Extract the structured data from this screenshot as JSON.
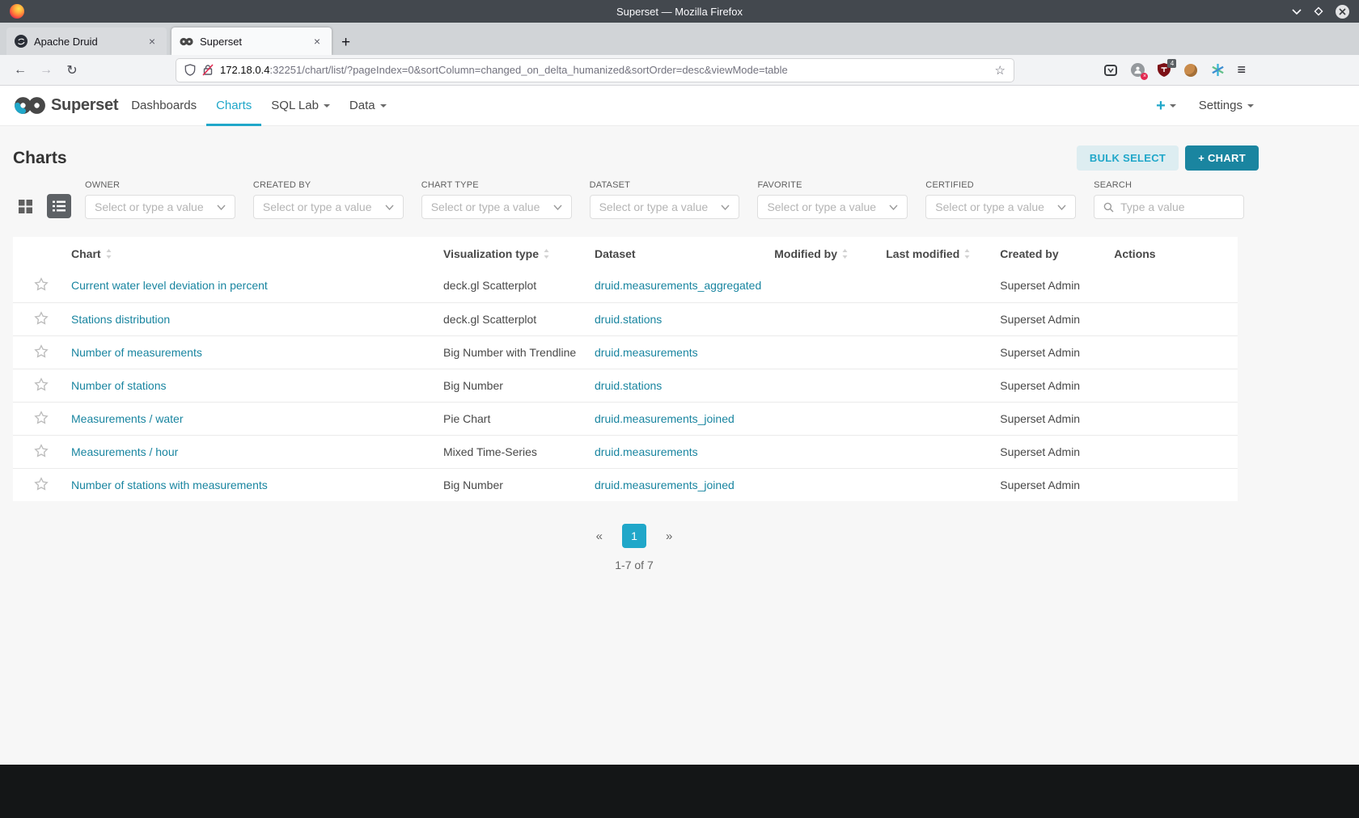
{
  "window": {
    "title": "Superset — Mozilla Firefox",
    "tabs": [
      {
        "title": "Apache Druid"
      },
      {
        "title": "Superset"
      }
    ],
    "url_host": "172.18.0.4",
    "url_rest": ":32251/chart/list/?pageIndex=0&sortColumn=changed_on_delta_humanized&sortOrder=desc&viewMode=table",
    "ublock_badge": "4"
  },
  "icons": {
    "back": "←",
    "forward": "→",
    "reload": "↻",
    "menu": "≡",
    "new_tab": "+",
    "close_tab": "×",
    "bookmark": "☆",
    "close_window": "×"
  },
  "nav": {
    "brand": "Superset",
    "items": [
      {
        "label": "Dashboards"
      },
      {
        "label": "Charts"
      },
      {
        "label": "SQL Lab"
      },
      {
        "label": "Data"
      }
    ],
    "add_label": "+",
    "settings": "Settings"
  },
  "page": {
    "title": "Charts",
    "bulk_select": "BULK SELECT",
    "new_chart": "+ CHART"
  },
  "filters": {
    "owner": {
      "label": "OWNER",
      "placeholder": "Select or type a value"
    },
    "created_by": {
      "label": "CREATED BY",
      "placeholder": "Select or type a value"
    },
    "chart_type": {
      "label": "CHART TYPE",
      "placeholder": "Select or type a value"
    },
    "dataset": {
      "label": "DATASET",
      "placeholder": "Select or type a value"
    },
    "favorite": {
      "label": "FAVORITE",
      "placeholder": "Select or type a value"
    },
    "certified": {
      "label": "CERTIFIED",
      "placeholder": "Select or type a value"
    },
    "search": {
      "label": "SEARCH",
      "placeholder": "Type a value"
    }
  },
  "table": {
    "columns": [
      {
        "label": "Chart",
        "sortable": true
      },
      {
        "label": "Visualization type",
        "sortable": true
      },
      {
        "label": "Dataset",
        "sortable": false
      },
      {
        "label": "Modified by",
        "sortable": true
      },
      {
        "label": "Last modified",
        "sortable": true
      },
      {
        "label": "Created by",
        "sortable": false
      },
      {
        "label": "Actions",
        "sortable": false
      }
    ],
    "rows": [
      {
        "chart": "Current water level deviation in percent",
        "viz_type": "deck.gl Scatterplot",
        "dataset": "druid.measurements_aggregated",
        "created_by": "Superset Admin"
      },
      {
        "chart": "Stations distribution",
        "viz_type": "deck.gl Scatterplot",
        "dataset": "druid.stations",
        "created_by": "Superset Admin"
      },
      {
        "chart": "Number of measurements",
        "viz_type": "Big Number with Trendline",
        "dataset": "druid.measurements",
        "created_by": "Superset Admin"
      },
      {
        "chart": "Number of stations",
        "viz_type": "Big Number",
        "dataset": "druid.stations",
        "created_by": "Superset Admin"
      },
      {
        "chart": "Measurements / water",
        "viz_type": "Pie Chart",
        "dataset": "druid.measurements_joined",
        "created_by": "Superset Admin"
      },
      {
        "chart": "Measurements / hour",
        "viz_type": "Mixed Time-Series",
        "dataset": "druid.measurements",
        "created_by": "Superset Admin"
      },
      {
        "chart": "Number of stations with measurements",
        "viz_type": "Big Number",
        "dataset": "druid.measurements_joined",
        "created_by": "Superset Admin"
      }
    ]
  },
  "pagination": {
    "prev": "«",
    "page": "1",
    "next": "»",
    "summary": "1-7 of 7"
  },
  "colors": {
    "accent": "#20a7c9",
    "link": "#1985a0",
    "primary_button": "#1a85a0"
  }
}
